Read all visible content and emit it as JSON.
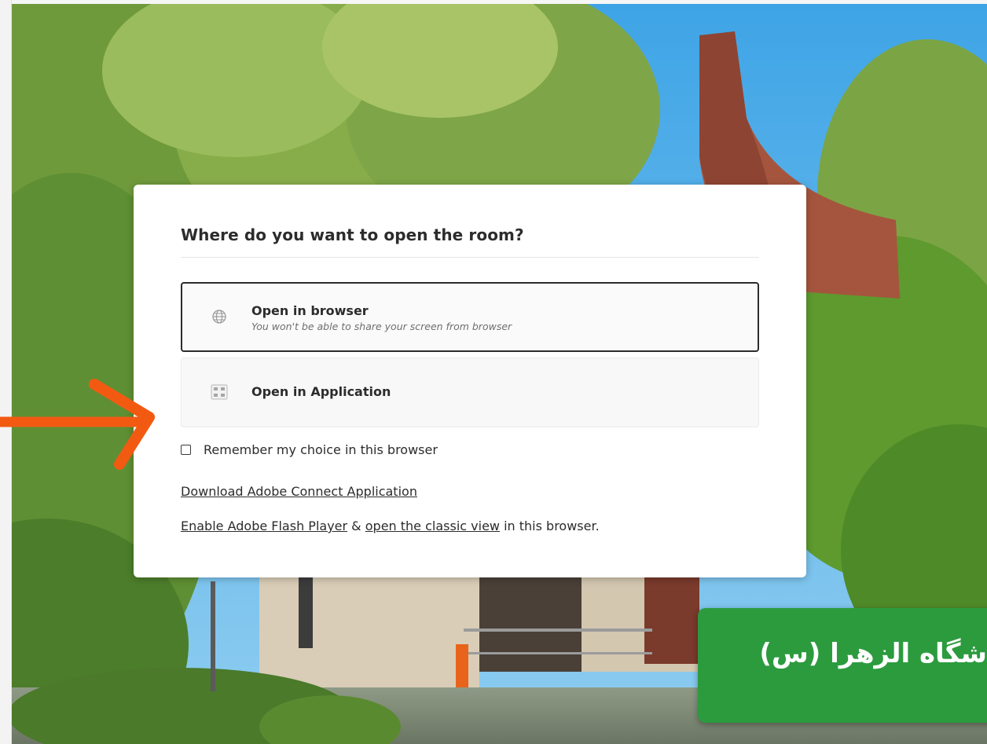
{
  "dialog": {
    "title": "Where do you want to open the room?",
    "options": [
      {
        "label": "Open in browser",
        "sublabel": "You won't be able to share your screen from browser",
        "icon": "globe-icon",
        "selected": true
      },
      {
        "label": "Open in Application",
        "icon": "application-icon",
        "selected": false
      }
    ],
    "remember_choice": {
      "label": "Remember my choice in this browser",
      "checked": false
    },
    "download_link": "Download Adobe Connect Application",
    "flash_line": {
      "enable_flash_link": "Enable Adobe Flash Player",
      "ampersand": " & ",
      "classic_view_link": "open the classic view",
      "suffix": " in this browser."
    }
  },
  "banner": {
    "text": "شگاه الزهرا (س)"
  },
  "colors": {
    "arrow": "#f25a12",
    "banner": "#2c9b3e",
    "sky": "#5ab2e6",
    "dialog_background": "#ffffff",
    "text": "#2c2c2c"
  }
}
